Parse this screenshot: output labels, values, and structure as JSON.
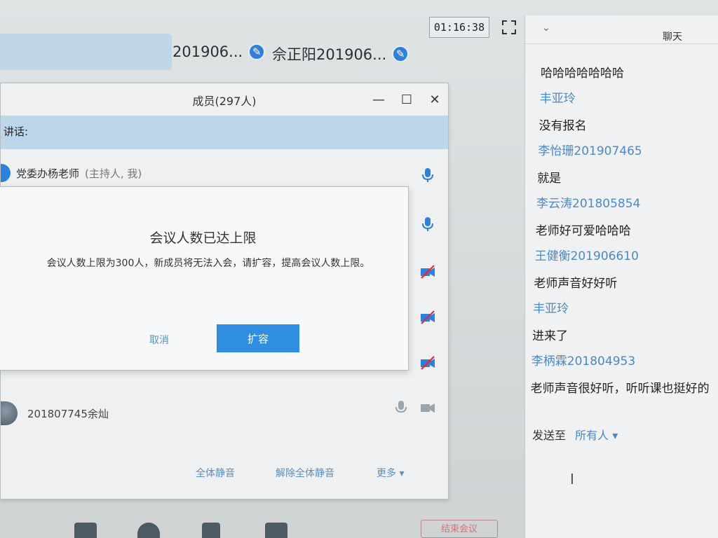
{
  "topbar": {
    "participants": [
      {
        "name": "201906..."
      },
      {
        "name": "佘正阳201906..."
      }
    ],
    "timer": "01:16:38"
  },
  "members": {
    "title": "成员(297人)",
    "speaking_label": "讲话:",
    "host": {
      "name": "党委办杨老师",
      "role": "(主持人, 我)"
    },
    "member": {
      "name": "201807745余灿"
    },
    "footer": {
      "mute_all": "全体静音",
      "unmute_all": "解除全体静音",
      "more": "更多 ▾"
    }
  },
  "dialog": {
    "title": "会议人数已达上限",
    "message": "会议人数上限为300人，新成员将无法入会，请扩容，提高会议人数上限。",
    "cancel": "取消",
    "expand": "扩容"
  },
  "chat": {
    "title": "聊天",
    "messages": [
      {
        "type": "text",
        "text": "哈哈哈哈哈哈哈"
      },
      {
        "type": "sender",
        "text": "丰亚玲"
      },
      {
        "type": "text",
        "text": "没有报名"
      },
      {
        "type": "sender",
        "text": "李怡珊201907465"
      },
      {
        "type": "text",
        "text": "就是"
      },
      {
        "type": "sender",
        "text": "李云涛201805854"
      },
      {
        "type": "text",
        "text": "老师好可爱哈哈哈"
      },
      {
        "type": "sender",
        "text": "王健衡201906610"
      },
      {
        "type": "text",
        "text": "老师声音好好听"
      },
      {
        "type": "sender",
        "text": "丰亚玲"
      },
      {
        "type": "text",
        "text": "进来了"
      },
      {
        "type": "sender",
        "text": "李柄霖201804953"
      },
      {
        "type": "text",
        "text": "老师声音很好听，听听课也挺好的"
      }
    ],
    "send_to_label": "发送至",
    "send_to_target": "所有人 ▾"
  },
  "bottom": {
    "end_label": "结束会议"
  },
  "colors": {
    "accent": "#2f8ee0",
    "link": "#4d88c9",
    "speaking_bar": "#bcd7ea"
  }
}
